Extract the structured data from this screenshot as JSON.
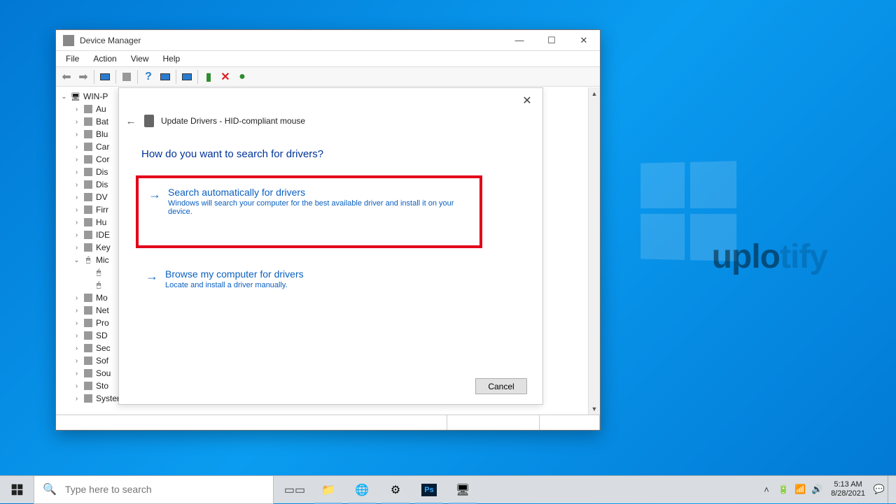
{
  "desktop": {
    "watermark_a": "uplo",
    "watermark_b": "tify"
  },
  "dm": {
    "title": "Device Manager",
    "menu": {
      "file": "File",
      "action": "Action",
      "view": "View",
      "help": "Help"
    },
    "tree": {
      "root": "WIN-P",
      "items": [
        "Au",
        "Bat",
        "Blu",
        "Car",
        "Cor",
        "Dis",
        "Dis",
        "DV",
        "Firr",
        "Hu",
        "IDE",
        "Key"
      ],
      "mice": {
        "label": "Mic",
        "child_a": "",
        "child_b": ""
      },
      "items2": [
        "Mo",
        "Net",
        "Pro",
        "SD",
        "Sec",
        "Sof",
        "Sou",
        "Sto",
        "System devices"
      ]
    }
  },
  "upd": {
    "breadcrumb": "Update Drivers - HID-compliant mouse",
    "heading": "How do you want to search for drivers?",
    "opt1_title": "Search automatically for drivers",
    "opt1_desc": "Windows will search your computer for the best available driver and install it on your device.",
    "opt2_title": "Browse my computer for drivers",
    "opt2_desc": "Locate and install a driver manually.",
    "cancel": "Cancel"
  },
  "taskbar": {
    "search_placeholder": "Type here to search",
    "time": "5:13 AM",
    "date": "8/28/2021"
  }
}
